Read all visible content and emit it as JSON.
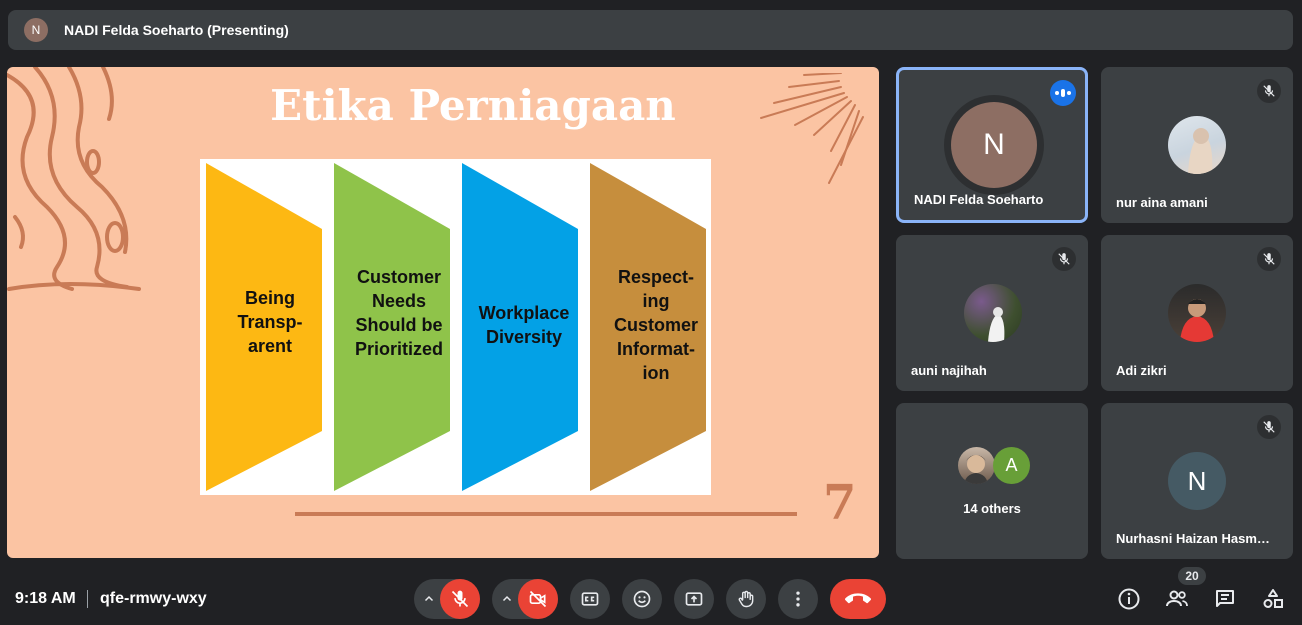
{
  "presenting_bar": {
    "avatar_initial": "N",
    "title": "NADI Felda Soeharto (Presenting)"
  },
  "slide": {
    "title": "Etika Perniagaan",
    "page_number": "7",
    "pillars": [
      {
        "label": "Being\nTransp-\narent",
        "color": "#fdb813"
      },
      {
        "label": "Customer\nNeeds\nShould be\nPrioritized",
        "color": "#8fc34a"
      },
      {
        "label": "Workplace\nDiversity",
        "color": "#03a1e6"
      },
      {
        "label": "Respect-\ning\nCustomer\nInformat-\nion",
        "color": "#c68e3d"
      }
    ]
  },
  "participants": [
    {
      "name": "NADI Felda Soeharto",
      "initial": "N",
      "speaking": true
    },
    {
      "name": "nur aina amani",
      "muted": true,
      "photo": true
    },
    {
      "name": "auni najihah",
      "muted": true,
      "photo": true
    },
    {
      "name": "Adi zikri",
      "muted": true,
      "photo": true
    },
    {
      "name": "14 others",
      "extra_initial": "A"
    },
    {
      "name": "Nurhasni Haizan Hasm…",
      "initial": "N",
      "muted": true
    }
  ],
  "bottom_bar": {
    "time": "9:18 AM",
    "meeting_code": "qfe-rmwy-wxy",
    "people_count": "20"
  },
  "colors": {
    "background": "#202124",
    "tile": "#3c4043",
    "danger": "#ea4335",
    "accent": "#8ab4f8",
    "speaking": "#1a73e8"
  }
}
